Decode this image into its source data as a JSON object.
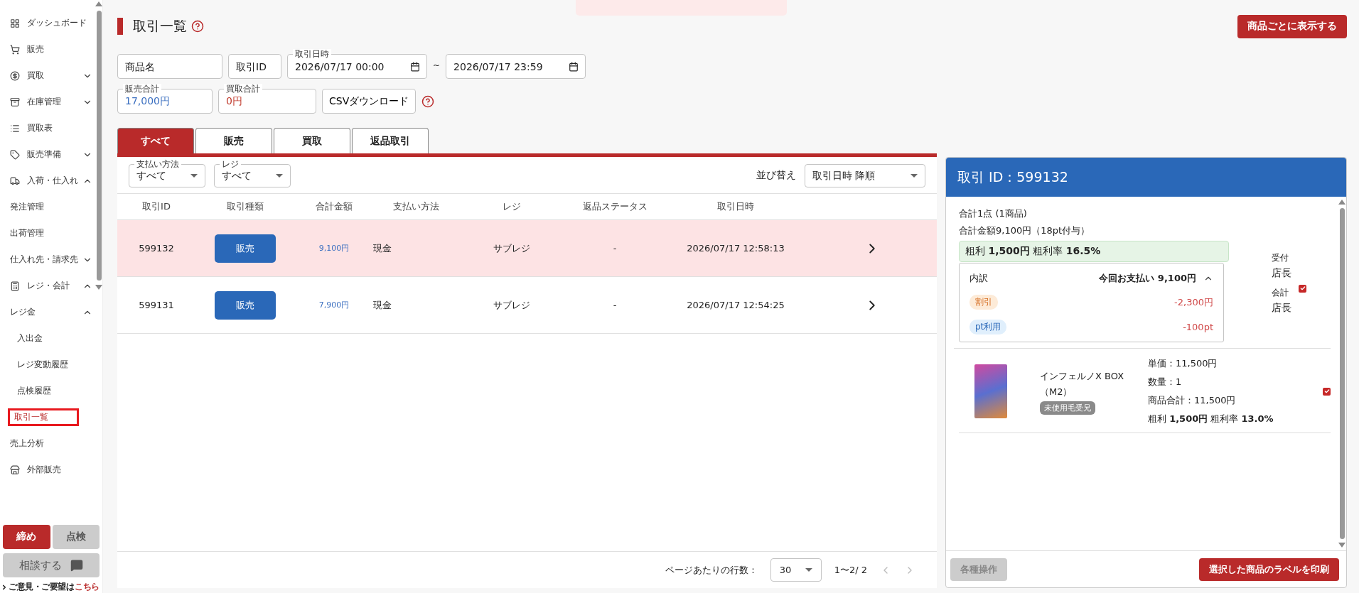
{
  "sidebar": {
    "items": [
      {
        "label": "ダッシュボード",
        "selected": false
      },
      {
        "label": "販売",
        "selected": false
      },
      {
        "label": "買取",
        "selected": false,
        "expanded": false
      },
      {
        "label": "在庫管理",
        "selected": false,
        "expanded": false
      },
      {
        "label": "買取表",
        "selected": false
      },
      {
        "label": "販売準備",
        "selected": false,
        "expanded": false
      },
      {
        "label": "入荷・仕入れ",
        "selected": false,
        "expanded": true,
        "children": [
          {
            "label": "発注管理",
            "selected": false
          },
          {
            "label": "出荷管理",
            "selected": false
          },
          {
            "label": "仕入れ先・請求先",
            "selected": false,
            "expanded": false
          }
        ]
      },
      {
        "label": "レジ・会計",
        "selected": false,
        "expanded": true,
        "children": [
          {
            "label": "レジ金",
            "selected": false,
            "expanded": true,
            "children": [
              {
                "label": "入出金",
                "selected": false
              },
              {
                "label": "レジ変動履歴",
                "selected": false
              },
              {
                "label": "点検履歴",
                "selected": false
              }
            ]
          },
          {
            "label": "取引一覧",
            "selected": true
          },
          {
            "label": "売上分析",
            "selected": false
          }
        ]
      },
      {
        "label": "外部販売",
        "selected": false
      }
    ],
    "buttons": [
      {
        "label": "締め",
        "kind": "primary"
      },
      {
        "label": "点検",
        "kind": "secondary"
      }
    ],
    "consult_button": "相談する",
    "feedback": {
      "text": "ご意見・ご要望は",
      "link": "こちら"
    }
  },
  "page": {
    "title": "取引一覧",
    "action_button": "商品ごとに表示する"
  },
  "filters": {
    "product_name": {
      "placeholder": "商品名"
    },
    "transaction_id": {
      "placeholder": "取引ID"
    },
    "date_label": "取引日時",
    "date_from": "2026/07/17 00:00",
    "date_separator": "~",
    "date_to": "2026/07/17 23:59",
    "sales_total": {
      "label": "販売合計",
      "value": "17,000円"
    },
    "purchase_total": {
      "label": "買取合計",
      "value": "0円"
    },
    "csv_button": "CSVダウンロード"
  },
  "tabs": [
    {
      "label": "すべて",
      "selected": true
    },
    {
      "label": "販売",
      "selected": false
    },
    {
      "label": "買取",
      "selected": false
    },
    {
      "label": "返品取引",
      "selected": false
    }
  ],
  "list_filters": {
    "payment": {
      "label": "支払い方法",
      "value": "すべて"
    },
    "register": {
      "label": "レジ",
      "value": "すべて"
    },
    "sort_label": "並び替え",
    "sort_value": "取引日時 降順"
  },
  "table": {
    "columns": [
      "取引ID",
      "取引種類",
      "合計金額",
      "支払い方法",
      "レジ",
      "返品ステータス",
      "取引日時"
    ],
    "rows": [
      {
        "selected": true,
        "id": "599132",
        "type": "販売",
        "total": "9,100円",
        "payment": "現金",
        "register": "サブレジ",
        "return_status": "-",
        "datetime": "2026/07/17 12:58:13"
      },
      {
        "selected": false,
        "id": "599131",
        "type": "販売",
        "total": "7,900円",
        "payment": "現金",
        "register": "サブレジ",
        "return_status": "-",
        "datetime": "2026/07/17 12:54:25"
      }
    ]
  },
  "pagination": {
    "rows_label": "ページあたりの行数：",
    "rows_value": "30",
    "range": "1〜2/ 2"
  },
  "detail": {
    "title": "取引 ID：599132",
    "count": "合計1点 (1商品)",
    "amount": "合計金額9,100円（18pt付与）",
    "profit": "粗利 **1,500円** 粗利率 **16.5%**",
    "breakdown": {
      "label": "内訳",
      "total": "今回お支払い 9,100円",
      "expanded": true,
      "lines": [
        {
          "kind": "discount",
          "tag": "割引",
          "value": "-2,300円"
        },
        {
          "kind": "points",
          "tag": "pt利用",
          "value": "-100pt"
        }
      ]
    },
    "staff": [
      {
        "role": "受付",
        "name": "店長"
      },
      {
        "role": "会計",
        "name": "店長"
      }
    ],
    "staff_checked": true,
    "items": [
      {
        "name": "インフェルノX BOX（M2）",
        "condition": "未使用毛受兄",
        "unit_price": "単価：11,500円",
        "quantity": "数量：1",
        "subtotal": "商品合計：11,500円",
        "profit": "粗利 **1,500円** 粗利率 **13.0%**",
        "checked": true
      }
    ],
    "buttons": [
      {
        "label": "各種操作",
        "kind": "disabled"
      },
      {
        "label": "選択した商品のラベルを印刷",
        "kind": "primary"
      }
    ]
  }
}
